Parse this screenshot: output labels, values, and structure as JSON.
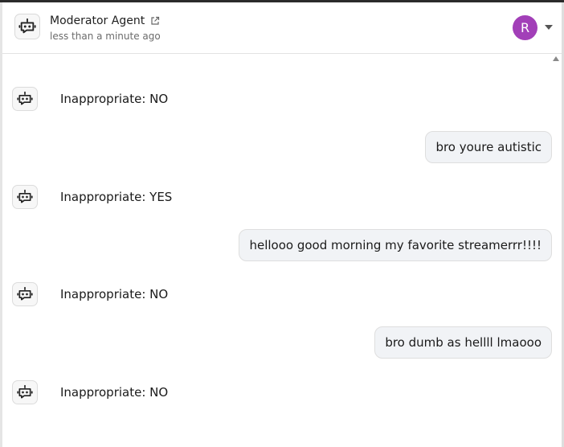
{
  "header": {
    "agent_name": "Moderator Agent",
    "timestamp": "less than a minute ago",
    "user_initial": "R",
    "avatar_color": "#a23fb8"
  },
  "messages": [
    {
      "role": "bot",
      "text": "Inappropriate: NO"
    },
    {
      "role": "user",
      "text": "bro youre autistic"
    },
    {
      "role": "bot",
      "text": "Inappropriate: YES"
    },
    {
      "role": "user",
      "text": "hellooo good morning my favorite streamerrr!!!!"
    },
    {
      "role": "bot",
      "text": "Inappropriate: NO"
    },
    {
      "role": "user",
      "text": "bro dumb as hellll lmaooo"
    },
    {
      "role": "bot",
      "text": "Inappropriate: NO"
    }
  ]
}
